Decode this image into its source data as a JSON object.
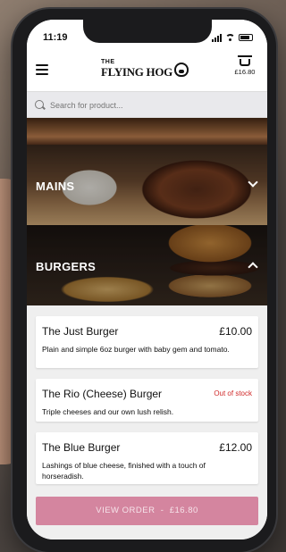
{
  "status": {
    "time": "11:19"
  },
  "header": {
    "logo_line1": "THE",
    "logo_line2": "FLYING HOG",
    "basket_total": "£16.80"
  },
  "search": {
    "placeholder": "Search for product..."
  },
  "categories": [
    {
      "label": "MAINS",
      "state": "collapsed"
    },
    {
      "label": "BURGERS",
      "state": "expanded"
    }
  ],
  "products": [
    {
      "name": "The Just Burger",
      "price": "£10.00",
      "description": "Plain and simple 6oz burger with baby gem and tomato."
    },
    {
      "name": "The Rio (Cheese) Burger",
      "stock_status": "Out of stock",
      "description": "Triple cheeses and our own lush relish."
    },
    {
      "name": "The Blue Burger",
      "price": "£12.00",
      "description": "Lashings of blue cheese, finished with a touch of horseradish."
    }
  ],
  "order_button": {
    "label": "VIEW ORDER",
    "separator": "-",
    "total": "£16.80"
  },
  "colors": {
    "order_button": "#d4859f",
    "out_of_stock": "#d02a2a"
  }
}
